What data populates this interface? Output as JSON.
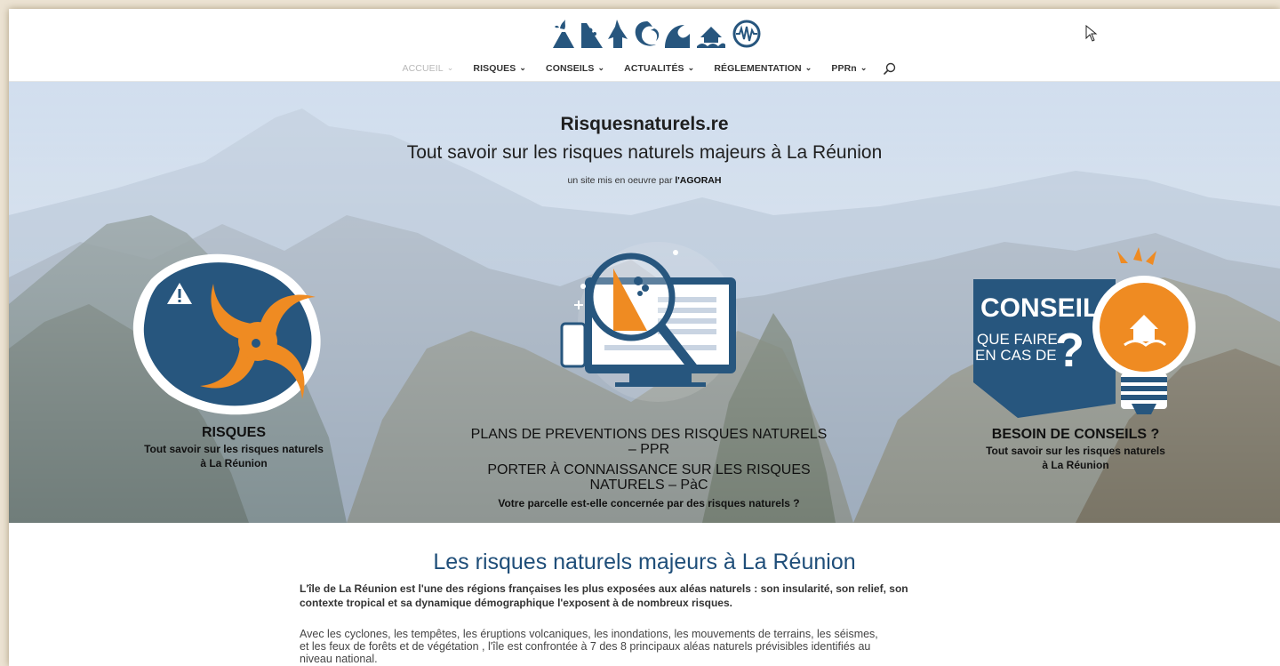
{
  "nav": {
    "items": [
      {
        "label": "ACCUEIL",
        "active": true
      },
      {
        "label": "RISQUES",
        "active": false
      },
      {
        "label": "CONSEILS",
        "active": false
      },
      {
        "label": "ACTUALITÉS",
        "active": false
      },
      {
        "label": "RÉGLEMENTATION",
        "active": false
      },
      {
        "label": "PPRn",
        "active": false
      }
    ],
    "icons": {
      "dropdown": "chevron-down-icon",
      "search": "search-icon"
    }
  },
  "logo": {
    "icons": [
      "volcano-icon",
      "landslide-icon",
      "forest-fire-icon",
      "wave-icon",
      "tsunami-icon",
      "flood-icon",
      "earthquake-icon"
    ]
  },
  "hero": {
    "site_name": "Risquesnaturels.re",
    "tagline": "Tout savoir sur les risques naturels majeurs à La Réunion",
    "credit_prefix": "un site mis en oeuvre par ",
    "credit_org": "l'AGORAH"
  },
  "cards": {
    "risques": {
      "title": "RISQUES",
      "subtitle_line1": "Tout savoir sur les risques naturels",
      "subtitle_line2": "à La Réunion"
    },
    "ppr": {
      "title1_line1": "PLANS DE PREVENTIONS DES RISQUES NATURELS",
      "title1_line2": "– PPR",
      "title2_line1": "PORTER À CONNAISSANCE SUR LES RISQUES",
      "title2_line2": "NATURELS – PàC",
      "subtitle": "Votre parcelle est-elle concernée par des risques naturels ?"
    },
    "conseils": {
      "badge_title": "CONSEILS",
      "badge_line1": "QUE FAIRE",
      "badge_line2": "EN CAS DE",
      "badge_mark": "?",
      "title": "BESOIN DE CONSEILS ?",
      "subtitle_line1": "Tout savoir sur les risques naturels",
      "subtitle_line2": "à La Réunion"
    }
  },
  "content": {
    "title": "Les risques naturels majeurs à La Réunion",
    "intro_line1": "L'île de La Réunion est l'une des régions françaises les plus exposées aux aléas naturels : son insularité, son relief, son",
    "intro_line2": "contexte tropical et sa dynamique démographique l'exposent à de nombreux risques.",
    "body_line1": "Avec les cyclones, les tempêtes, les éruptions volcaniques, les inondations, les mouvements de terrains, les séismes,",
    "body_line2": "et les feux de forêts et de végétation , l'île est confrontée à 7 des 8 principaux aléas naturels prévisibles identifiés au",
    "body_line3": "niveau national."
  },
  "colors": {
    "navy": "#27567e",
    "orange": "#ef8b22",
    "title_blue": "#1f4e79",
    "sky": "#c9d8ea"
  }
}
